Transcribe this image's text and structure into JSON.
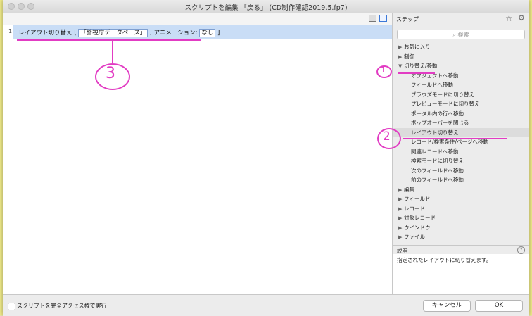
{
  "window": {
    "title": "スクリプトを編集 「戻る」 (CD制作確認2019.5.fp7)"
  },
  "editor": {
    "line_number": "1",
    "step_name": "レイアウト切り替え [",
    "layout_token": "「警視庁データベース」",
    "separator": "; アニメーション:",
    "animation_token": "なし",
    "close": "]"
  },
  "sidebar": {
    "title": "ステップ",
    "search_placeholder": "検索",
    "categories": [
      {
        "label": "お気に入り",
        "expanded": false
      },
      {
        "label": "制御",
        "expanded": false
      },
      {
        "label": "切り替え/移動",
        "expanded": true
      },
      {
        "label": "編集",
        "expanded": false
      },
      {
        "label": "フィールド",
        "expanded": false
      },
      {
        "label": "レコード",
        "expanded": false
      },
      {
        "label": "対象レコード",
        "expanded": false
      },
      {
        "label": "ウインドウ",
        "expanded": false
      },
      {
        "label": "ファイル",
        "expanded": false
      }
    ],
    "nav_steps": [
      "オブジェクトへ移動",
      "フィールドへ移動",
      "ブラウズモードに切り替え",
      "プレビューモードに切り替え",
      "ポータル内の行へ移動",
      "ポップオーバーを閉じる",
      "レイアウト切り替え",
      "レコード/検索条件/ページへ移動",
      "関連レコードへ移動",
      "検索モードに切り替え",
      "次のフィールドへ移動",
      "前のフィールドへ移動"
    ],
    "selected_step": "レイアウト切り替え",
    "description_title": "説明",
    "description_text": "指定されたレイアウトに切り替えます。"
  },
  "footer": {
    "checkbox_label": "スクリプトを完全アクセス権で実行",
    "cancel_label": "キャンセル",
    "ok_label": "OK"
  },
  "annotations": {
    "one": "1",
    "two": "2",
    "three": "3"
  },
  "colors": {
    "annotation": "#e23cc3",
    "selection": "#c9ddf6"
  }
}
